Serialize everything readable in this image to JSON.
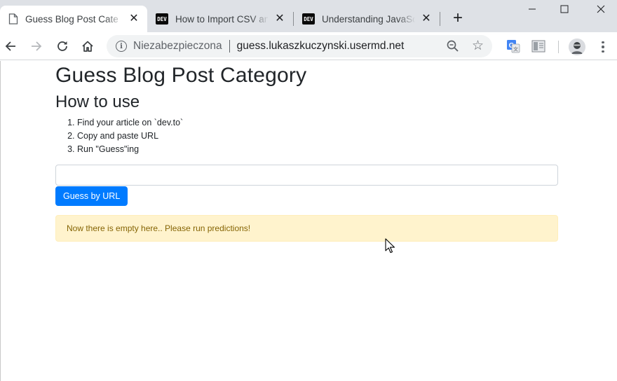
{
  "browser": {
    "tabs": [
      {
        "title": "Guess Blog Post Category",
        "icon": "document-icon",
        "active": true
      },
      {
        "title": "How to Import CSV and",
        "icon": "dev-logo-icon",
        "active": false
      },
      {
        "title": "Understanding JavaScript",
        "icon": "dev-logo-icon",
        "active": false
      }
    ],
    "dev_logo_text": "DEV",
    "new_tab_glyph": "+",
    "close_glyph": "✕",
    "window_controls": {
      "minimize": "—",
      "maximize": "☐",
      "close": "✕"
    },
    "address_bar": {
      "security_label": "Niezabezpieczona",
      "url": "guess.lukaszkuczynski.usermd.net"
    }
  },
  "page": {
    "title": "Guess Blog Post Category",
    "how_to_heading": "How to use",
    "steps": [
      "Find your article on `dev.to`",
      "Copy and paste URL",
      "Run \"Guess\"ing"
    ],
    "url_input": {
      "value": "",
      "placeholder": ""
    },
    "guess_button_label": "Guess by URL",
    "alert_message": "Now there is empty here.. Please run predictions!"
  },
  "colors": {
    "primary_button": "#007bff",
    "alert_background": "#fff3cd",
    "alert_text": "#856404",
    "tabstrip": "#dee1e6"
  }
}
